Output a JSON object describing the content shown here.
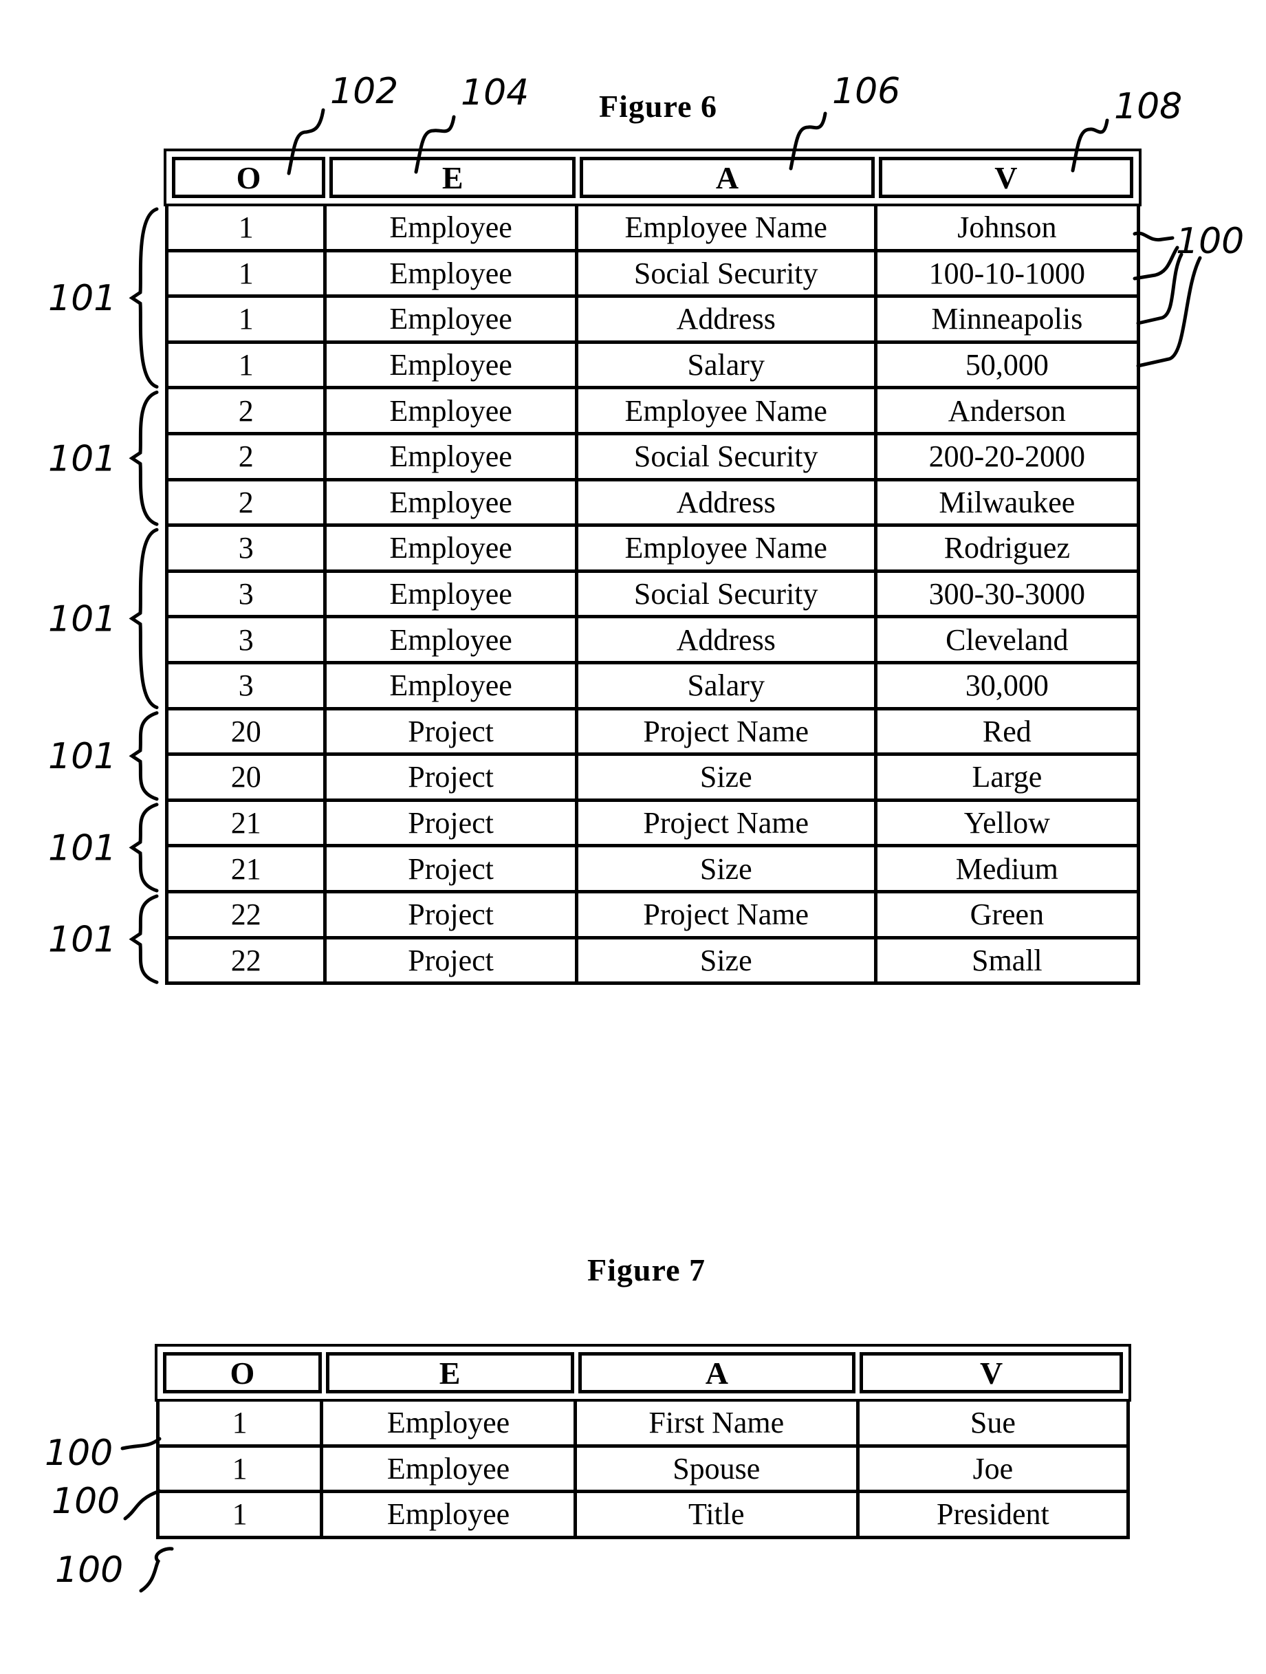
{
  "figure6": {
    "title": "Figure 6",
    "headers": [
      "O",
      "E",
      "A",
      "V"
    ],
    "rows": [
      [
        "1",
        "Employee",
        "Employee Name",
        "Johnson"
      ],
      [
        "1",
        "Employee",
        "Social Security",
        "100-10-1000"
      ],
      [
        "1",
        "Employee",
        "Address",
        "Minneapolis"
      ],
      [
        "1",
        "Employee",
        "Salary",
        "50,000"
      ],
      [
        "2",
        "Employee",
        "Employee Name",
        "Anderson"
      ],
      [
        "2",
        "Employee",
        "Social Security",
        "200-20-2000"
      ],
      [
        "2",
        "Employee",
        "Address",
        "Milwaukee"
      ],
      [
        "3",
        "Employee",
        "Employee Name",
        "Rodriguez"
      ],
      [
        "3",
        "Employee",
        "Social Security",
        "300-30-3000"
      ],
      [
        "3",
        "Employee",
        "Address",
        "Cleveland"
      ],
      [
        "3",
        "Employee",
        "Salary",
        "30,000"
      ],
      [
        "20",
        "Project",
        "Project Name",
        "Red"
      ],
      [
        "20",
        "Project",
        "Size",
        "Large"
      ],
      [
        "21",
        "Project",
        "Project Name",
        "Yellow"
      ],
      [
        "21",
        "Project",
        "Size",
        "Medium"
      ],
      [
        "22",
        "Project",
        "Project Name",
        "Green"
      ],
      [
        "22",
        "Project",
        "Size",
        "Small"
      ]
    ],
    "column_refs": [
      "102",
      "104",
      "106",
      "108"
    ],
    "group_ref": "101",
    "groups": [
      {
        "label": "101",
        "rows": 4
      },
      {
        "label": "101",
        "rows": 3
      },
      {
        "label": "101",
        "rows": 4
      },
      {
        "label": "101",
        "rows": 2
      },
      {
        "label": "101",
        "rows": 2
      },
      {
        "label": "101",
        "rows": 2
      }
    ],
    "row_ref": "100"
  },
  "figure7": {
    "title": "Figure 7",
    "headers": [
      "O",
      "E",
      "A",
      "V"
    ],
    "rows": [
      [
        "1",
        "Employee",
        "First Name",
        "Sue"
      ],
      [
        "1",
        "Employee",
        "Spouse",
        "Joe"
      ],
      [
        "1",
        "Employee",
        "Title",
        "President"
      ]
    ],
    "row_refs": [
      "100",
      "100",
      "100"
    ]
  }
}
